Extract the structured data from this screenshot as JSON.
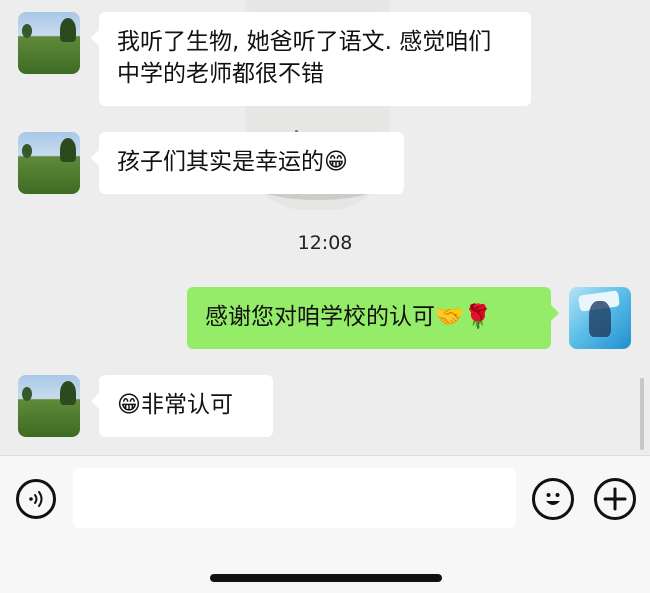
{
  "messages": [
    {
      "side": "in",
      "text": "我听了生物, 她爸听了语文. 感觉咱们中学的老师都很不错"
    },
    {
      "side": "in",
      "text": "孩子们其实是幸运的😁"
    },
    {
      "side": "out",
      "text": "感谢您对咱学校的认可🤝🌹"
    },
    {
      "side": "in",
      "text": "😁非常认可"
    }
  ],
  "timestamp": "12:08",
  "input": {
    "value": ""
  },
  "icons": {
    "voice": "voice-icon",
    "emoji": "emoji-icon",
    "plus": "plus-icon"
  },
  "colors": {
    "background": "#ededed",
    "incoming_bubble": "#ffffff",
    "outgoing_bubble": "#95ec69",
    "toolbar": "#f7f7f7"
  }
}
